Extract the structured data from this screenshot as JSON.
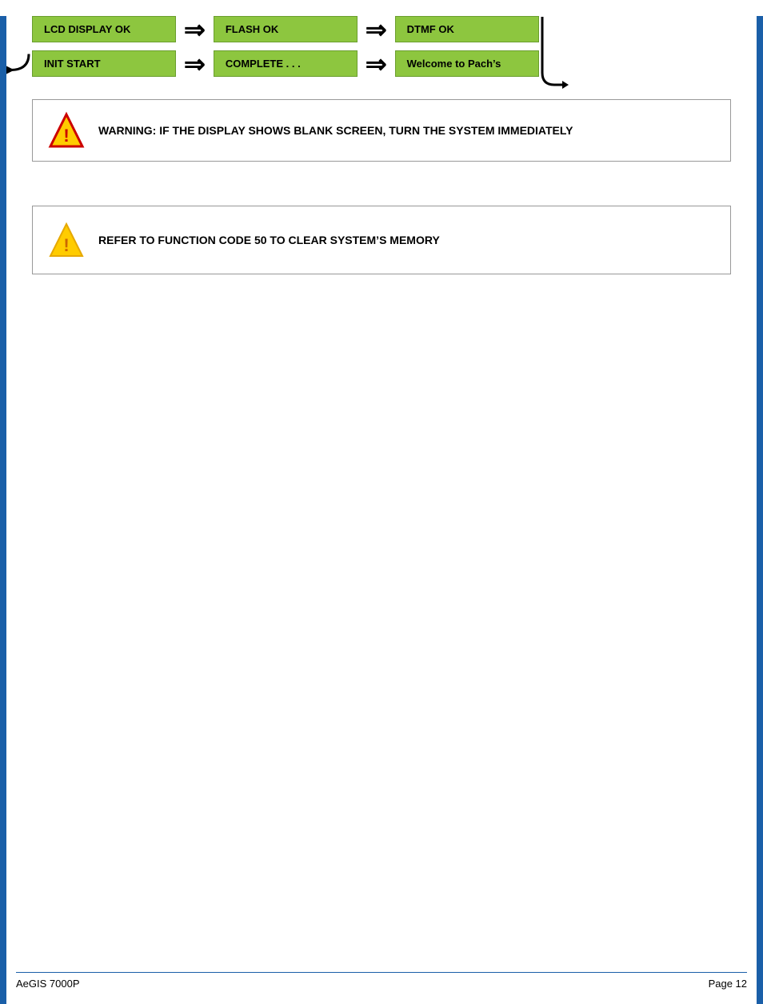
{
  "page": {
    "title": "AeGIS 7000P",
    "page_number": "Page 12"
  },
  "flow_diagram": {
    "row1": {
      "box1": "LCD DISPLAY OK",
      "box2": "FLASH OK",
      "box3": "DTMF OK"
    },
    "row2": {
      "box1": "INIT START",
      "box2": "COMPLETE . . .",
      "box3": "Welcome to Pach’s"
    }
  },
  "warning": {
    "text": "WARNING: IF THE DISPLAY SHOWS BLANK SCREEN, TURN THE SYSTEM IMMEDIATELY"
  },
  "note": {
    "text": "REFER TO FUNCTION CODE 50 TO CLEAR SYSTEM’S MEMORY"
  },
  "icons": {
    "warning_triangle": "warning-triangle-icon",
    "note_triangle": "note-triangle-icon",
    "arrow_right": "⇒",
    "back_arrow": "↵"
  }
}
